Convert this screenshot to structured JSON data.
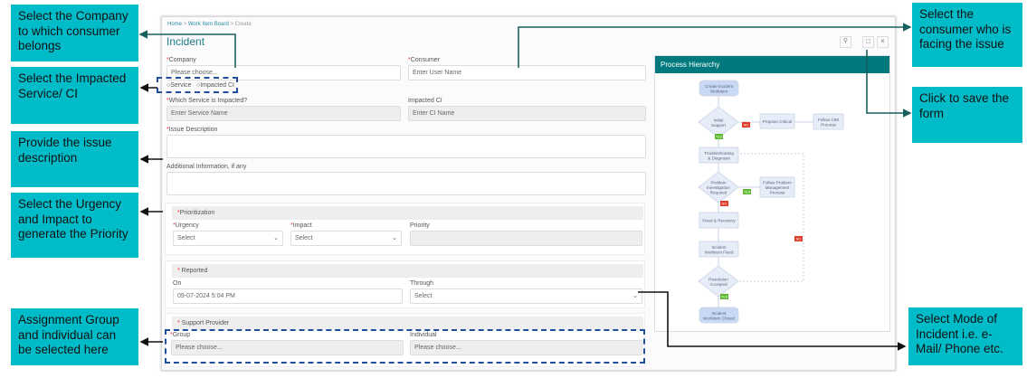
{
  "callouts": {
    "company": "Select the Company to which consumer belongs",
    "service": "Select the Impacted Service/ CI",
    "description": "Provide the issue description",
    "priority": "Select the Urgency and Impact to generate the Priority",
    "assignment": "Assignment Group and individual can be selected here",
    "consumer": "Select the consumer who is facing the issue",
    "save": "Click to save the form",
    "mode": "Select Mode of Incident i.e. e-Mail/ Phone etc."
  },
  "breadcrumb": {
    "home": "Home",
    "board": "Work Item Board",
    "create": "Create",
    "sep": ">"
  },
  "title": "Incident",
  "form": {
    "company_label": "Company",
    "company_placeholder": "Please choose...",
    "consumer_label": "Consumer",
    "consumer_placeholder": "Enter User Name",
    "radio_service": "Service",
    "radio_ci": "Impacted CI",
    "service_label": "Which Service is Impacted?",
    "service_placeholder": "Enter Service Name",
    "ci_label": "Impacted CI",
    "ci_placeholder": "Enter CI Name",
    "issue_label": "Issue Description",
    "additional_label": "Additional Information, if any",
    "prioritization": "Prioritization",
    "urgency_label": "Urgency",
    "urgency_value": "Select",
    "impact_label": "Impact",
    "impact_value": "Select",
    "priority_label": "Priority",
    "reported": "Reported",
    "on_label": "On",
    "on_value": "09-07-2024 5:04 PM",
    "through_label": "Through",
    "through_value": "Select",
    "support": "Support Provider",
    "group_label": "Group",
    "group_placeholder": "Please choose...",
    "individual_label": "Individual",
    "individual_placeholder": "Please choose..."
  },
  "toolbar": {
    "close": "×"
  },
  "process": {
    "title": "Process Hierarchy",
    "nodes": {
      "create": [
        "Create Incident",
        "Workitem"
      ],
      "initial": [
        "Initial",
        "Support"
      ],
      "propose": [
        "Propose Critical"
      ],
      "cim": [
        "Follow CIM",
        "Process"
      ],
      "trouble": [
        "Troubleshooting",
        "& Diagnosis"
      ],
      "problem": [
        "Problem",
        "Investigation",
        "Required"
      ],
      "followproblem": [
        "Follow Problem",
        "Management",
        "Process"
      ],
      "fixed": [
        "Fixed & Recovery"
      ],
      "workfixed": [
        "Incident",
        "Workitem Fixed"
      ],
      "resolution": [
        "Resolution",
        "Accepted"
      ],
      "closed": [
        "Incident",
        "Workitem Closed"
      ]
    },
    "yes": "YES",
    "no": "NO"
  },
  "colors": {
    "callout": "#00bcc9",
    "teal": "#00797e",
    "line": "#1a5f5f",
    "dashed": "#1f4e9c",
    "yes": "#5cb82e",
    "no": "#e03a2a"
  }
}
